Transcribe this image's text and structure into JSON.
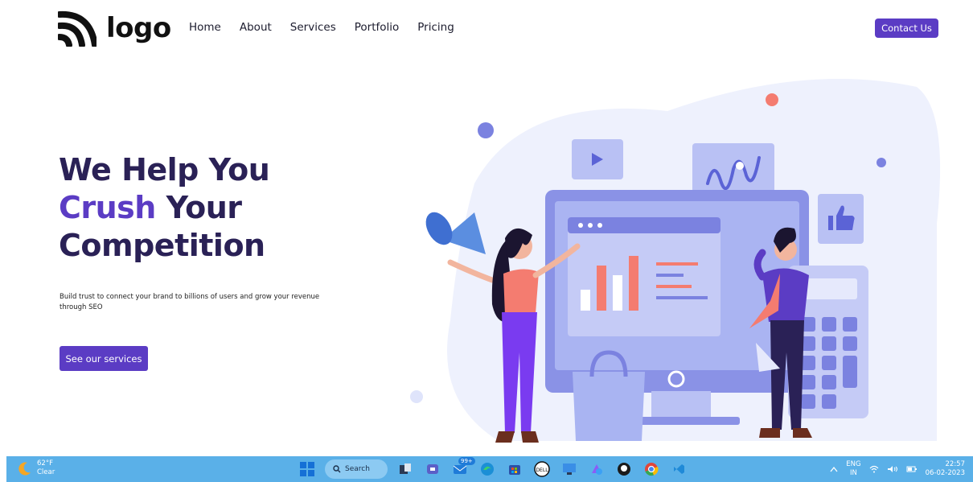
{
  "header": {
    "logo_text": "logo",
    "nav": [
      "Home",
      "About",
      "Services",
      "Portfolio",
      "Pricing"
    ],
    "contact_label": "Contact Us"
  },
  "hero": {
    "title_line1": "We Help You",
    "title_accent": "Crush",
    "title_line2_rest": " Your",
    "title_line3": "Competition",
    "subtitle": "Build trust to connect your brand to billions of users and grow your revenue through SEO",
    "cta_label": "See our services"
  },
  "colors": {
    "primary": "#5b3cc4",
    "heading": "#2a2156",
    "illustration_blue": "#a9b4f2",
    "illustration_dark": "#7b82e0",
    "coral": "#f47c70",
    "taskbar": "#5ab0e8"
  },
  "taskbar": {
    "weather_temp": "62°F",
    "weather_desc": "Clear",
    "search_label": "Search",
    "mail_badge": "99+",
    "lang_top": "ENG",
    "lang_bottom": "IN",
    "time": "22:57",
    "date": "06-02-2023",
    "icons": [
      "windows-start-icon",
      "search-icon",
      "task-view-icon",
      "teams-icon",
      "mail-icon",
      "edge-icon",
      "store-icon",
      "dell-icon",
      "monitor-icon",
      "photos-icon",
      "github-icon",
      "chrome-icon",
      "vscode-icon"
    ]
  }
}
